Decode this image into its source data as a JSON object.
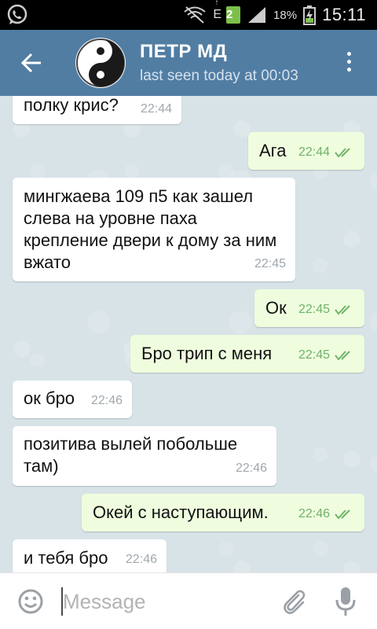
{
  "status_bar": {
    "battery_percent": "18%",
    "sim_label": "2",
    "network_type": "E",
    "time": "15:11"
  },
  "header": {
    "title": "ПЕТР МД",
    "status": "last seen today at 00:03"
  },
  "messages": [
    {
      "direction": "in",
      "text": "полку крис?",
      "time": "22:44"
    },
    {
      "direction": "out",
      "text": "Ага",
      "time": "22:44"
    },
    {
      "direction": "in",
      "text": "мингжаева 109 п5 как зашел слева на уровне паха крепление двери к дому за ним вжато",
      "time": "22:45"
    },
    {
      "direction": "out",
      "text": "Ок",
      "time": "22:45"
    },
    {
      "direction": "out",
      "text": "Бро трип с меня",
      "time": "22:45"
    },
    {
      "direction": "in",
      "text": "ок бро",
      "time": "22:46"
    },
    {
      "direction": "in",
      "text": "позитива вылей побольше там)",
      "time": "22:46"
    },
    {
      "direction": "out",
      "text": "Окей с наступающим.",
      "time": "22:46"
    },
    {
      "direction": "in",
      "text": "и тебя бро",
      "time": "22:46"
    }
  ],
  "input": {
    "placeholder": "Message"
  },
  "icons": {
    "back": "arrow-left-icon",
    "menu": "more-vert-icon",
    "emoji": "smiley-icon",
    "attach": "paperclip-icon",
    "mic": "microphone-icon",
    "read_receipt": "double-check-icon"
  },
  "colors": {
    "header": "#527da3",
    "outgoing_bubble": "#effdde",
    "incoming_bubble": "#ffffff",
    "check": "#6fb36a"
  }
}
